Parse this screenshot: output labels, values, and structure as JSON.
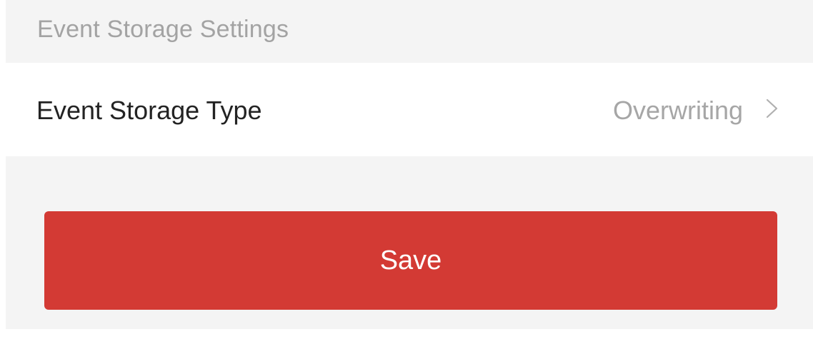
{
  "section": {
    "title": "Event Storage Settings"
  },
  "event_storage_type": {
    "label": "Event Storage Type",
    "value": "Overwriting",
    "icon": "chevron-right-icon"
  },
  "actions": {
    "save_label": "Save"
  },
  "colors": {
    "save_button": "#d33a34",
    "section_background": "#f4f4f4",
    "label_text": "#232323",
    "value_text": "#a6a6a6",
    "header_text": "#a3a3a3"
  }
}
